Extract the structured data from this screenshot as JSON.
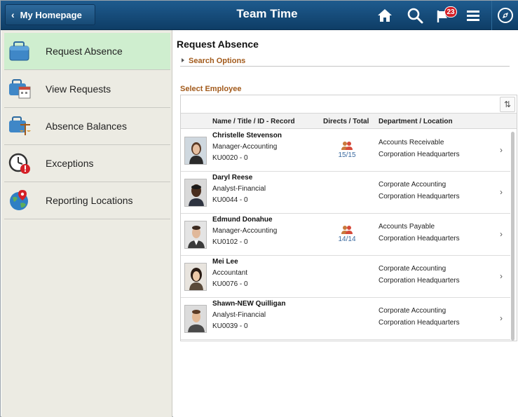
{
  "header": {
    "home_label": "My Homepage",
    "title": "Team Time",
    "notification_count": "23"
  },
  "sidebar": {
    "items": [
      {
        "label": "Request Absence",
        "icon": "briefcase-icon"
      },
      {
        "label": "View Requests",
        "icon": "calendar-briefcase-icon"
      },
      {
        "label": "Absence Balances",
        "icon": "scales-briefcase-icon"
      },
      {
        "label": "Exceptions",
        "icon": "clock-alert-icon"
      },
      {
        "label": "Reporting Locations",
        "icon": "globe-pin-icon"
      }
    ]
  },
  "main": {
    "page_title": "Request Absence",
    "search_options": "Search Options",
    "select_employee": "Select Employee",
    "columns": {
      "name": "Name / Title / ID - Record",
      "directs": "Directs / Total",
      "dept": "Department / Location"
    },
    "rows": [
      {
        "name": "Christelle Stevenson",
        "title": "Manager-Accounting",
        "id": "KU0020 - 0",
        "directs": "15/15",
        "dept": "Accounts Receivable",
        "location": "Corporation Headquarters"
      },
      {
        "name": "Daryl Reese",
        "title": "Analyst-Financial",
        "id": "KU0044 - 0",
        "directs": "",
        "dept": "Corporate Accounting",
        "location": "Corporation Headquarters"
      },
      {
        "name": "Edmund Donahue",
        "title": "Manager-Accounting",
        "id": "KU0102 - 0",
        "directs": "14/14",
        "dept": "Accounts Payable",
        "location": "Corporation Headquarters"
      },
      {
        "name": "Mei Lee",
        "title": "Accountant",
        "id": "KU0076 - 0",
        "directs": "",
        "dept": "Corporate Accounting",
        "location": "Corporation Headquarters"
      },
      {
        "name": "Shawn-NEW Quilligan",
        "title": "Analyst-Financial",
        "id": "KU0039 - 0",
        "directs": "",
        "dept": "Corporate Accounting",
        "location": "Corporation Headquarters"
      }
    ]
  },
  "colors": {
    "header": "#174a75",
    "accent_label": "#a25a1b",
    "active_nav": "#cfeecf",
    "badge": "#d52027"
  }
}
